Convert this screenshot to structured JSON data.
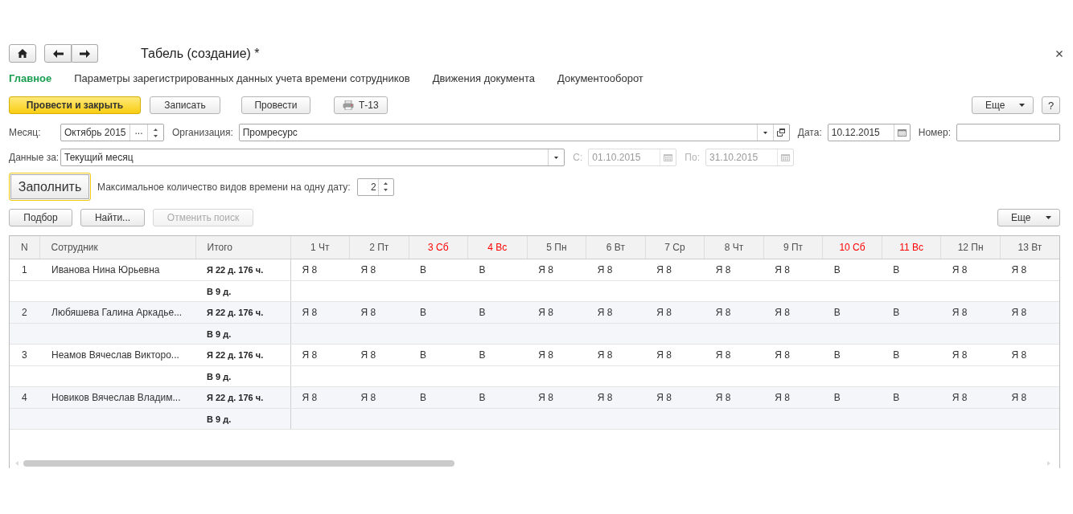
{
  "window": {
    "title": "Табель (создание) *"
  },
  "tabs": [
    {
      "label": "Главное",
      "selected": true
    },
    {
      "label": "Параметры зарегистрированных данных учета времени сотрудников",
      "selected": false
    },
    {
      "label": "Движения документа",
      "selected": false
    },
    {
      "label": "Документооборот",
      "selected": false
    }
  ],
  "toolbar": {
    "buttons": [
      {
        "label": "Провести и закрыть",
        "kind": "primary"
      },
      {
        "label": "Записать",
        "kind": "plain"
      },
      {
        "label": "Провести",
        "kind": "plain"
      },
      {
        "label": "Т-13",
        "kind": "print"
      }
    ],
    "more": "Еще",
    "help": "?"
  },
  "form_rows": [
    [
      {
        "kind": "period",
        "label": "Месяц:",
        "value": "Октябрь 2015",
        "button": "...",
        "disabled": false
      },
      {
        "kind": "reference",
        "label": "Организация:",
        "value": "Промресурс",
        "disabled": false
      },
      {
        "kind": "date",
        "label": "Дата:",
        "value": "10.12.2015",
        "disabled": false
      },
      {
        "kind": "text",
        "label": "Номер:",
        "disabled": false
      }
    ],
    [
      {
        "kind": "choice",
        "label": "Данные за:",
        "value": "Текущий месяц",
        "disabled": false
      },
      {
        "kind": "date",
        "label": "С:",
        "value": "01.10.2015",
        "disabled": true
      },
      {
        "kind": "date",
        "label": "По:",
        "value": "31.10.2015",
        "disabled": true
      }
    ]
  ],
  "fill": {
    "button": {
      "label": "Заполнить",
      "focused": true
    },
    "max_kinds": {
      "label": "Максимальное количество видов времени на одну дату:",
      "value": "2"
    }
  },
  "table_commands": {
    "buttons": [
      {
        "label": "Подбор",
        "disabled": false
      },
      {
        "label": "Найти...",
        "disabled": false
      },
      {
        "label": "Отменить поиск",
        "disabled": true
      }
    ],
    "more": "Еще"
  },
  "table": {
    "columns": [
      "N",
      "Сотрудник",
      "Итого"
    ],
    "days": [
      {
        "label": "1 Чт",
        "weekend": false
      },
      {
        "label": "2 Пт",
        "weekend": false
      },
      {
        "label": "3 Сб",
        "weekend": true
      },
      {
        "label": "4 Вс",
        "weekend": true
      },
      {
        "label": "5 Пн",
        "weekend": false
      },
      {
        "label": "6 Вт",
        "weekend": false
      },
      {
        "label": "7 Ср",
        "weekend": false
      },
      {
        "label": "8 Чт",
        "weekend": false
      },
      {
        "label": "9 Пт",
        "weekend": false
      },
      {
        "label": "10 Сб",
        "weekend": true
      },
      {
        "label": "11 Вс",
        "weekend": true
      },
      {
        "label": "12 Пн",
        "weekend": false
      },
      {
        "label": "13 Вт",
        "weekend": false
      }
    ],
    "rows": [
      {
        "n": "1",
        "employee": "Иванова Нина Юрьевна",
        "totals": [
          "Я 22 д. 176 ч.",
          "В 9 д."
        ],
        "days": [
          "Я 8",
          "Я 8",
          "В",
          "В",
          "Я 8",
          "Я 8",
          "Я 8",
          "Я 8",
          "Я 8",
          "В",
          "В",
          "Я 8",
          "Я 8"
        ]
      },
      {
        "n": "2",
        "employee": "Любяшева Галина Аркадье...",
        "totals": [
          "Я 22 д. 176 ч.",
          "В 9 д."
        ],
        "days": [
          "Я 8",
          "Я 8",
          "В",
          "В",
          "Я 8",
          "Я 8",
          "Я 8",
          "Я 8",
          "Я 8",
          "В",
          "В",
          "Я 8",
          "Я 8"
        ]
      },
      {
        "n": "3",
        "employee": "Неамов Вячеслав Викторо...",
        "totals": [
          "Я 22 д. 176 ч.",
          "В 9 д."
        ],
        "days": [
          "Я 8",
          "Я 8",
          "В",
          "В",
          "Я 8",
          "Я 8",
          "Я 8",
          "Я 8",
          "Я 8",
          "В",
          "В",
          "Я 8",
          "Я 8"
        ]
      },
      {
        "n": "4",
        "employee": "Новиков Вячеслав Владим...",
        "totals": [
          "Я 22 д. 176 ч.",
          "В 9 д."
        ],
        "days": [
          "Я 8",
          "Я 8",
          "В",
          "В",
          "Я 8",
          "Я 8",
          "Я 8",
          "Я 8",
          "Я 8",
          "В",
          "В",
          "Я 8",
          "Я 8"
        ]
      }
    ]
  }
}
